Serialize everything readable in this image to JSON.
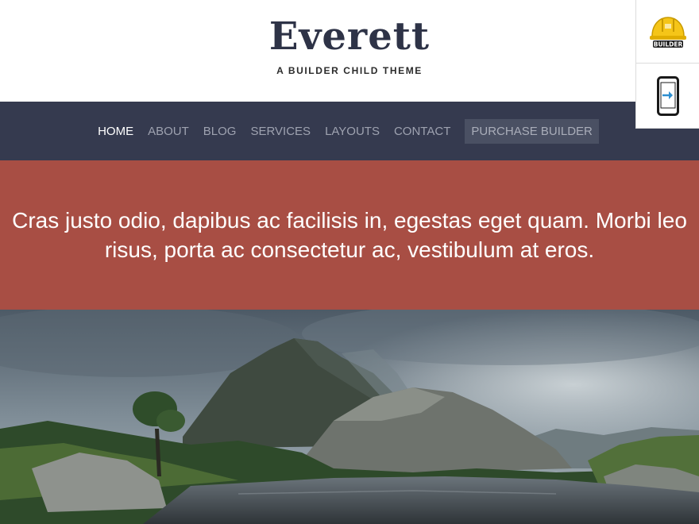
{
  "header": {
    "title": "Everett",
    "tagline": "A BUILDER CHILD THEME"
  },
  "tools": {
    "builder_badge": "BUILDER",
    "builder_icon": "builder-hardhat-icon",
    "mobile_icon": "mobile-view-icon"
  },
  "nav": {
    "items": [
      {
        "label": "HOME"
      },
      {
        "label": "ABOUT"
      },
      {
        "label": "BLOG"
      },
      {
        "label": "SERVICES"
      },
      {
        "label": "LAYOUTS"
      },
      {
        "label": "CONTACT"
      },
      {
        "label": "PURCHASE BUILDER"
      }
    ]
  },
  "banner": {
    "text": "Cras justo odio, dapibus ac facilisis in, egestas eget quam. Morbi leo risus, porta ac consectetur ac, vestibulum at eros."
  },
  "colors": {
    "nav_bg": "#353a4f",
    "banner_bg": "#a84e44",
    "title": "#2e3347"
  }
}
